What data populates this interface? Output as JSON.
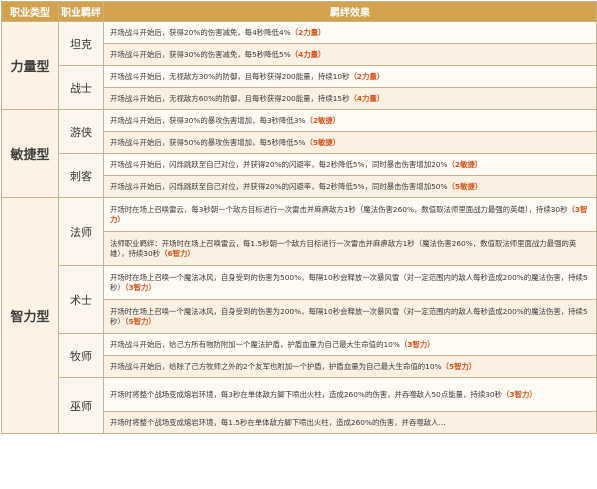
{
  "header": {
    "col1": "职业类型",
    "col2": "职业羁绊",
    "col3": "羁绊效果"
  },
  "rows": [
    {
      "name": "力量型",
      "classes": [
        {
          "name": "坦克",
          "effects": [
            {
              "text": "开场战斗开始后，获得20%的伤害减免，每4秒降低4%",
              "tag": "（2力量）"
            },
            {
              "text": "开场战斗开始后，获得30%的伤害减免，每5秒降低5%",
              "tag": "（4力量）"
            }
          ]
        },
        {
          "name": "战士",
          "effects": [
            {
              "text": "开场战斗开始后，无视敌方30%的防御，且每秒获得200能量，持续10秒",
              "tag": "（2力量）"
            },
            {
              "text": "开场战斗开始后，无视敌方60%的防御，且每秒获得200能量，持续15秒",
              "tag": "（4力量）"
            }
          ]
        }
      ]
    },
    {
      "name": "敏捷型",
      "classes": [
        {
          "name": "游侠",
          "effects": [
            {
              "text": "开场战斗开始后，获得30%的暴攻伤害增加，每3秒降低3%",
              "tag": "（2敏捷）"
            },
            {
              "text": "开场战斗开始后，获得50%的暴攻伤害增加，每5秒降低5%",
              "tag": "（5敏捷）"
            }
          ]
        },
        {
          "name": "刺客",
          "effects": [
            {
              "text": "开场战斗开始后，闪烁跳跃至自己对位，并获得20%的闪避率，每2秒降低5%，同时暴击伤害增加20%",
              "tag": "（2敏捷）"
            },
            {
              "text": "开场战斗开始后，闪烁跳跃至自己对位，并获得20%的闪避率，每2秒降低5%，同时暴击伤害增加50%",
              "tag": "（5敏捷）"
            }
          ]
        }
      ]
    },
    {
      "name": "智力型",
      "classes": [
        {
          "name": "法师",
          "effects": [
            {
              "text": "开场时在场上召唤雷云，每3秒朝一个敌方目标进行一次雷击并麻痹敌方1秒（魔法伤害260%，数值取法师里面战力最强的英雄），持续30秒",
              "tag": "（3智力）"
            },
            {
              "text": "法师职业羁绊：开场时在场上召唤雷云，每1.5秒朝一个敌方目标进行一次雷击并麻痹敌方1秒（魔法伤害260%，数值取法师里面战力最强的英雄），持续30秒",
              "tag": "（6智力）"
            }
          ]
        },
        {
          "name": "术士",
          "effects": [
            {
              "text": "开场时在场上召唤一个魔法冰风，自身受到的伤害为500%，每隔10秒会释放一次暴风雪（对一定范围内的敌人每秒造成200%的魔法伤害，持续5秒）",
              "tag": "（3智力）"
            },
            {
              "text": "开场时在场上召唤一个魔法冰风，自身受到的伤害为200%，每隔10秒会释放一次暴风雪（对一定范围内的敌人每秒造成200%的魔法伤害，持续5秒）",
              "tag": "（5智力）"
            }
          ]
        },
        {
          "name": "牧师",
          "effects": [
            {
              "text": "开场战斗开始后，给己方所有物防附加一个魔法护盾，护盾血量为自己最大生命值的10%",
              "tag": "（3智力）"
            },
            {
              "text": "开场战斗开始后，给除了己方牧师之外的2个友军也附加一个护盾，护盾血量为自己最大生命值的10%",
              "tag": "（5智力）"
            }
          ]
        },
        {
          "name": "巫师",
          "effects": [
            {
              "text": "开场时将整个战场变成熔岩环境，每3秒在单体敌方脚下喷出火柱，造成260%的伤害，并吞噬敌人50点能量，持续30秒",
              "tag": "（3智力）"
            },
            {
              "text": "开场时将整个战场变成熔岩环境，每1.5秒在单体敌方脚下喷出火柱，造成260%的伤害，并吞噬敌人...",
              "tag": ""
            }
          ]
        }
      ]
    }
  ]
}
